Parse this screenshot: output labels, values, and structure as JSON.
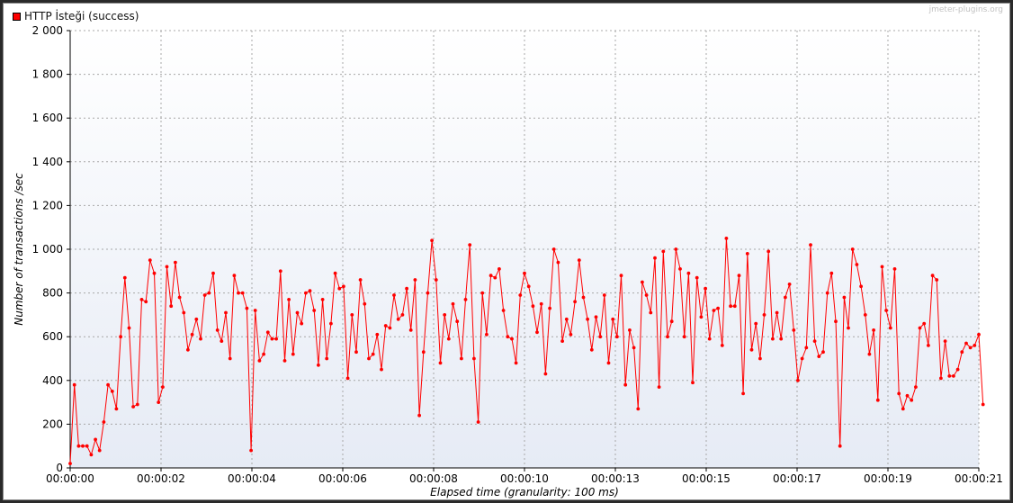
{
  "legend": {
    "label": "HTTP İsteği (success)",
    "color": "#ff0000"
  },
  "watermark": "jmeter-plugins.org",
  "chart_data": {
    "type": "line",
    "xlabel": "Elapsed time (granularity: 100 ms)",
    "ylabel": "Number of transactions /sec",
    "ylim": [
      0,
      2000
    ],
    "xlim": [
      0,
      21.6
    ],
    "y_ticks": [
      0,
      200,
      400,
      600,
      800,
      1000,
      1200,
      1400,
      1600,
      1800,
      2000
    ],
    "y_tick_labels": [
      "0",
      "200",
      "400",
      "600",
      "800",
      "1 000",
      "1 200",
      "1 400",
      "1 600",
      "1 800",
      "2 000"
    ],
    "x_ticks": [
      0,
      2.16,
      4.32,
      6.48,
      8.64,
      10.8,
      12.96,
      15.12,
      17.28,
      19.44,
      21.6
    ],
    "x_tick_labels": [
      "00:00:00",
      "00:00:02",
      "00:00:04",
      "00:00:06",
      "00:00:08",
      "00:00:10",
      "00:00:13",
      "00:00:15",
      "00:00:17",
      "00:00:19",
      "00:00:21"
    ],
    "grid": true,
    "legend_position": "top-left",
    "series": [
      {
        "name": "HTTP İsteği (success)",
        "color": "#ff0000",
        "x_start": 0,
        "x_step": 0.1,
        "values": [
          20,
          380,
          100,
          100,
          100,
          60,
          130,
          80,
          210,
          380,
          350,
          270,
          600,
          870,
          640,
          280,
          290,
          770,
          760,
          950,
          890,
          300,
          370,
          920,
          740,
          940,
          780,
          710,
          540,
          610,
          680,
          590,
          790,
          800,
          890,
          630,
          580,
          710,
          500,
          880,
          800,
          800,
          730,
          80,
          720,
          490,
          520,
          620,
          590,
          590,
          900,
          490,
          770,
          520,
          710,
          660,
          800,
          810,
          720,
          470,
          770,
          500,
          660,
          890,
          820,
          830,
          410,
          700,
          530,
          860,
          750,
          500,
          520,
          610,
          450,
          650,
          640,
          790,
          680,
          700,
          820,
          630,
          860,
          240,
          530,
          800,
          1040,
          860,
          480,
          700,
          590,
          750,
          670,
          500,
          770,
          1020,
          500,
          210,
          800,
          610,
          880,
          870,
          910,
          720,
          600,
          590,
          480,
          790,
          890,
          830,
          740,
          620,
          750,
          430,
          730,
          1000,
          940,
          580,
          680,
          610,
          760,
          950,
          780,
          680,
          540,
          690,
          600,
          790,
          480,
          680,
          600,
          880,
          380,
          630,
          550,
          270,
          850,
          790,
          710,
          960,
          370,
          990,
          600,
          670,
          1000,
          910,
          600,
          890,
          390,
          870,
          690,
          820,
          590,
          720,
          730,
          560,
          1050,
          740,
          740,
          880,
          340,
          980,
          540,
          660,
          500,
          700,
          990,
          590,
          710,
          590,
          780,
          840,
          630,
          400,
          500,
          550,
          1020,
          580,
          510,
          530,
          800,
          890,
          670,
          100,
          780,
          640,
          1000,
          930,
          830,
          700,
          520,
          630,
          310,
          920,
          720,
          640,
          910,
          340,
          270,
          330,
          310,
          370,
          640,
          660,
          560,
          880,
          860,
          410,
          580,
          420,
          420,
          450,
          530,
          570,
          550,
          560,
          610,
          290
        ]
      }
    ]
  }
}
